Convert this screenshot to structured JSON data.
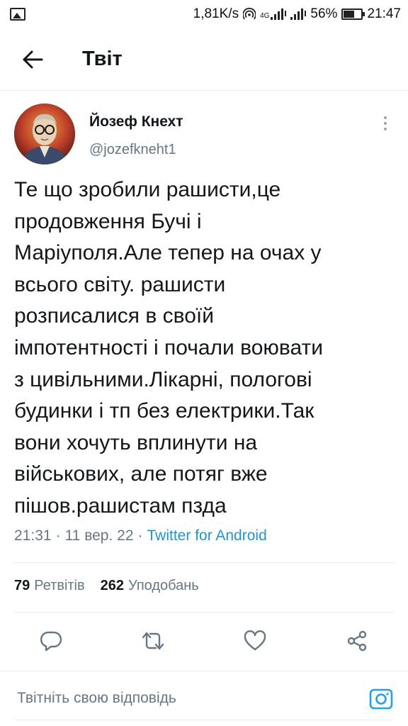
{
  "status_bar": {
    "net_speed": "1,81K/s",
    "network_type": "4G",
    "battery_percent": "56%",
    "battery_level": 0.56,
    "time": "21:47"
  },
  "header": {
    "title": "Твіт",
    "back_icon": "arrow-left-icon"
  },
  "tweet": {
    "author_name": "Йозеф Кнехт",
    "author_handle": "@jozefkneht1",
    "text": "Те що зробили рашисти,це\nпродовження Бучі і\nМаріуполя.Але тепер на очах у\nвсього світу. рашисти\nрозписалися в своїй\nімпотентності і почали воювати\nз цивільними.Лікарні, пологові\nбудинки і тп без електрики.Так\nвони хочуть вплинути на\nвійськових, але потяг вже\nпішов.рашистам пзда",
    "time": "21:31",
    "separator": "·",
    "date": "11 вер. 22",
    "source": "Twitter for Android",
    "retweets_count": "79",
    "retweets_label": "Ретвітів",
    "likes_count": "262",
    "likes_label": "Уподобань"
  },
  "actions": {
    "reply_icon": "comment-bubble-icon",
    "retweet_icon": "retweet-icon",
    "like_icon": "heart-icon",
    "share_icon": "share-icon"
  },
  "reply_bar": {
    "placeholder": "Твітніть свою відповідь",
    "camera_icon": "camera-icon"
  },
  "colors": {
    "accent": "#1da1f2",
    "secondary_text": "#657786",
    "primary_text": "#14171a",
    "divider": "#e6ecf0"
  }
}
